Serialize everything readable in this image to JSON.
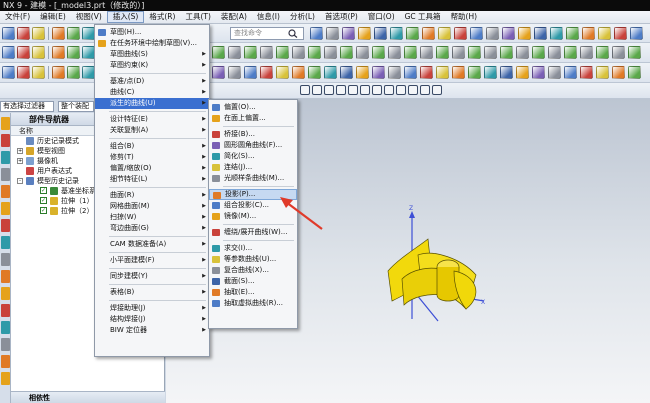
{
  "title": "NX 9 - 建模 - [_model3.prt（修改的）]",
  "menubar": [
    "文件(F)",
    "编辑(E)",
    "视图(V)",
    "插入(S)",
    "格式(R)",
    "工具(T)",
    "装配(A)",
    "信息(I)",
    "分析(L)",
    "首选项(P)",
    "窗口(O)",
    "GC 工具箱",
    "帮助(H)"
  ],
  "menubar_active": "插入(S)",
  "toolbar": {
    "search_placeholder": "查找命令",
    "filter_value": "有选择过滤器",
    "assembly_value": "整个装配"
  },
  "navigator": {
    "title": "部件导航器",
    "column_name": "名称",
    "rows": [
      {
        "label": "历史记录模式",
        "depth": 0
      },
      {
        "label": "模型视图",
        "depth": 0,
        "expand": "+"
      },
      {
        "label": "摄像机",
        "depth": 0,
        "expand": "+"
      },
      {
        "label": "用户表达式",
        "depth": 0
      },
      {
        "label": "模型历史记录",
        "depth": 0,
        "expand": "-"
      },
      {
        "label": "基准坐标系（0）",
        "depth": 1,
        "checked": true
      },
      {
        "label": "拉伸（1）",
        "depth": 1,
        "checked": true
      },
      {
        "label": "拉伸（2）",
        "depth": 1,
        "checked": true
      }
    ],
    "bottom_panel": "相依性"
  },
  "insert_menu": [
    {
      "label": "草图(H)...",
      "icon": "sketch-icon"
    },
    {
      "label": "在任务环境中绘制草图(V)...",
      "icon": "sketch-task-icon"
    },
    {
      "label": "草图曲线(S)",
      "submenu": true
    },
    {
      "label": "草图约束(K)",
      "submenu": true
    },
    {
      "sep": true
    },
    {
      "label": "基准/点(D)",
      "submenu": true
    },
    {
      "label": "曲线(C)",
      "submenu": true
    },
    {
      "label": "派生的曲线(U)",
      "submenu": true,
      "active": true
    },
    {
      "sep": true
    },
    {
      "label": "设计特征(E)",
      "submenu": true
    },
    {
      "label": "关联复制(A)",
      "submenu": true
    },
    {
      "sep": true
    },
    {
      "label": "组合(B)",
      "submenu": true
    },
    {
      "label": "修剪(T)",
      "submenu": true
    },
    {
      "label": "偏置/缩放(O)",
      "submenu": true
    },
    {
      "label": "细节特征(L)",
      "submenu": true
    },
    {
      "sep": true
    },
    {
      "label": "曲面(R)",
      "submenu": true
    },
    {
      "label": "网格曲面(M)",
      "submenu": true
    },
    {
      "label": "扫掠(W)",
      "submenu": true
    },
    {
      "label": "弯边曲面(G)",
      "submenu": true
    },
    {
      "sep": true
    },
    {
      "label": "CAM 数据准备(A)",
      "submenu": true
    },
    {
      "sep": true
    },
    {
      "label": "小平面建模(F)",
      "submenu": true
    },
    {
      "sep": true
    },
    {
      "label": "同步建模(Y)",
      "submenu": true
    },
    {
      "sep": true
    },
    {
      "label": "表格(B)",
      "submenu": true
    },
    {
      "sep": true
    },
    {
      "label": "焊接助理(J)",
      "submenu": true
    },
    {
      "label": "结构焊接(J)",
      "submenu": true
    },
    {
      "label": "BIW 定位器",
      "submenu": true
    }
  ],
  "derived_menu": [
    {
      "label": "偏置(O)...",
      "icon": "offset-curve-icon"
    },
    {
      "label": "在面上偏置...",
      "icon": "offset-in-face-icon"
    },
    {
      "sep": true
    },
    {
      "label": "桥接(B)...",
      "icon": "bridge-curve-icon"
    },
    {
      "label": "圆形圆角曲线(F)...",
      "icon": "fillet-curve-icon"
    },
    {
      "label": "简化(S)...",
      "icon": "simplify-curve-icon"
    },
    {
      "label": "连结(J)...",
      "icon": "join-curve-icon"
    },
    {
      "label": "光顺样条曲线(M)...",
      "icon": "smooth-spline-icon"
    },
    {
      "sep": true
    },
    {
      "label": "投影(P)...",
      "icon": "project-curve-icon",
      "highlight": true
    },
    {
      "label": "组合投影(C)...",
      "icon": "combined-projection-icon"
    },
    {
      "label": "镜像(M)...",
      "icon": "mirror-curve-icon"
    },
    {
      "sep": true
    },
    {
      "label": "缠绕/展开曲线(W)...",
      "icon": "wrap-curve-icon"
    },
    {
      "sep": true
    },
    {
      "label": "求交(I)...",
      "icon": "intersect-curve-icon"
    },
    {
      "label": "等参数曲线(U)...",
      "icon": "isoparametric-curve-icon"
    },
    {
      "label": "复合曲线(X)...",
      "icon": "composite-curve-icon"
    },
    {
      "label": "截面(S)...",
      "icon": "section-curve-icon"
    },
    {
      "label": "抽取(E)...",
      "icon": "extract-curve-icon"
    },
    {
      "label": "抽取虚拟曲线(R)...",
      "icon": "extract-virtual-curve-icon"
    }
  ],
  "colors": {
    "highlight": "#c6d9f1",
    "active": "#3a6fd0",
    "model": "#f2d90c",
    "arrow": "#e03a2a",
    "axis": "#3d4fd6"
  }
}
